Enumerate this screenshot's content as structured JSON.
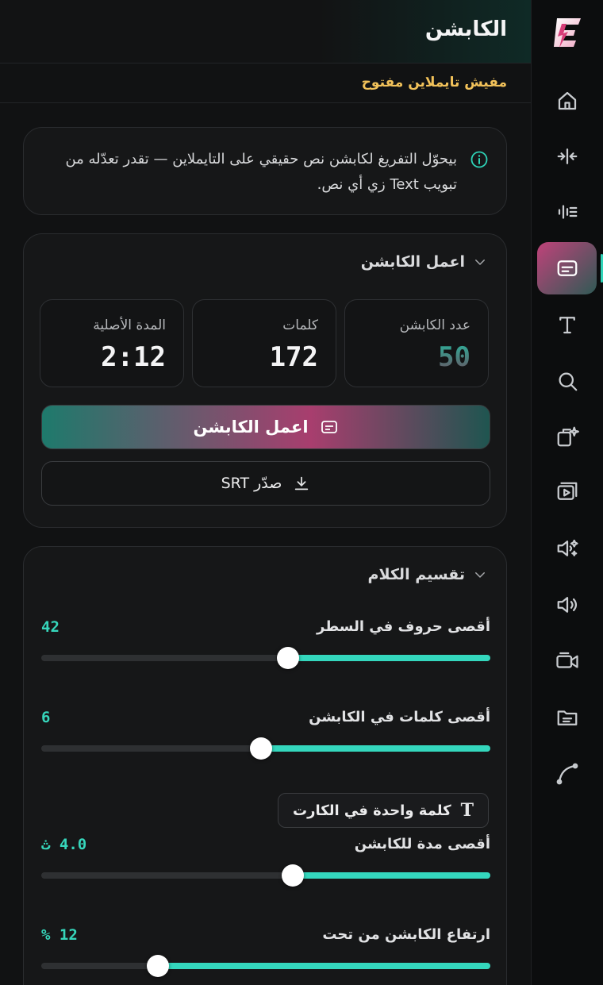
{
  "app": {
    "logo_letter": "E"
  },
  "header": {
    "title": "الكابشن"
  },
  "notice": {
    "text": "مفيش تايملاين مفتوح"
  },
  "info": {
    "text": "بيحوّل التفريغ لكابشن نص حقيقي على التايملاين — تقدر تعدّله من تبويب Text زي أي نص."
  },
  "generate_section": {
    "title": "اعمل الكابشن",
    "stats": [
      {
        "label": "عدد الكابشن",
        "value": "50"
      },
      {
        "label": "كلمات",
        "value": "172"
      },
      {
        "label": "المدة الأصلية",
        "value": "2:12"
      }
    ],
    "generate_label": "اعمل الكابشن",
    "export_label": "صدّر SRT"
  },
  "split_section": {
    "title": "تقسيم الكلام",
    "sliders": [
      {
        "label": "أقصى حروف في السطر",
        "display": "42",
        "fraction": 0.55
      },
      {
        "label": "أقصى كلمات في الكابشن",
        "display": "6",
        "fraction": 0.49
      },
      {
        "label": "أقصى مدة للكابشن",
        "display": "4.0 ث",
        "fraction": 0.56
      },
      {
        "label": "ارتفاع الكابشن من تحت",
        "display": "12 %",
        "fraction": 0.26
      }
    ],
    "one_word_label": "كلمة واحدة في الكارت"
  },
  "rail": {
    "items": [
      {
        "icon": "home-icon"
      },
      {
        "icon": "split-icon"
      },
      {
        "icon": "audio-wave-icon"
      },
      {
        "icon": "captions-icon",
        "active": true
      },
      {
        "icon": "text-icon"
      },
      {
        "icon": "search-icon"
      },
      {
        "icon": "magic-copy-icon"
      },
      {
        "icon": "video-player-icon"
      },
      {
        "icon": "voice-sparkle-icon"
      },
      {
        "icon": "volume-icon"
      },
      {
        "icon": "camera-icon"
      },
      {
        "icon": "folder-icon"
      },
      {
        "icon": "curve-icon"
      }
    ]
  },
  "colors": {
    "accent": "#34d7bd",
    "warning": "#f2c25a",
    "brand_pink": "#c0427a"
  }
}
